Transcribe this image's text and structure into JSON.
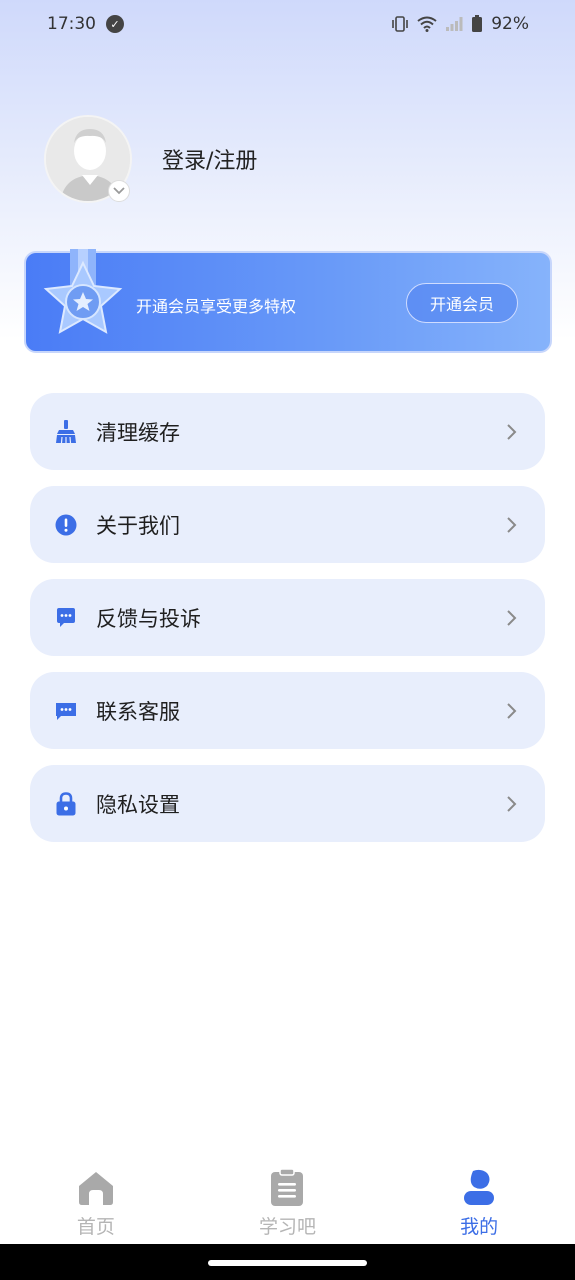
{
  "status_bar": {
    "time": "17:30",
    "battery": "92%",
    "icons": [
      "check-circle-icon",
      "vibrate-icon",
      "wifi-icon",
      "signal-icon",
      "battery-icon"
    ]
  },
  "profile": {
    "login_label": "登录/注册"
  },
  "vip": {
    "text": "开通会员享受更多特权",
    "button_label": "开通会员"
  },
  "menu": {
    "items": [
      {
        "label": "清理缓存",
        "icon": "broom-icon"
      },
      {
        "label": "关于我们",
        "icon": "info-icon"
      },
      {
        "label": "反馈与投诉",
        "icon": "feedback-icon"
      },
      {
        "label": "联系客服",
        "icon": "chat-icon"
      },
      {
        "label": "隐私设置",
        "icon": "lock-icon"
      }
    ]
  },
  "bottom_nav": {
    "items": [
      {
        "label": "首页",
        "icon": "home-icon",
        "active": false
      },
      {
        "label": "学习吧",
        "icon": "clipboard-icon",
        "active": false
      },
      {
        "label": "我的",
        "icon": "person-icon",
        "active": true
      }
    ]
  },
  "colors": {
    "accent": "#3c6ee6",
    "menu_bg": "#e8eefc",
    "inactive": "#b5b5b5"
  }
}
